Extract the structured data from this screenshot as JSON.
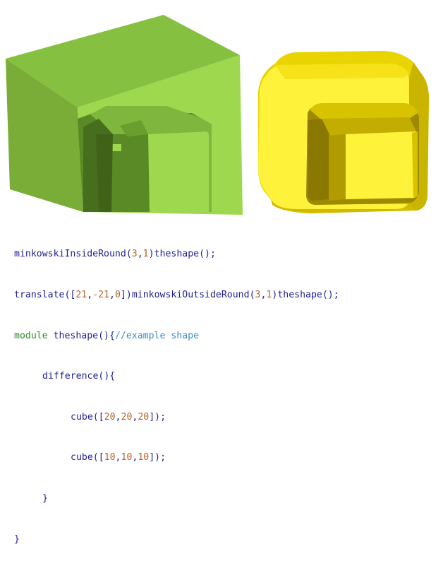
{
  "render": {
    "background": "#ffffff",
    "colors": {
      "green_light": "#9dd84f",
      "green_mid": "#7fb63d",
      "green_dark": "#5a8a26",
      "green_deep": "#476e1c",
      "yellow_light": "#fff23a",
      "yellow_mid": "#ead400",
      "yellow_dark": "#b7a100",
      "yellow_deep": "#8a7800"
    },
    "objects": [
      "minkowski-inside-round-shape",
      "minkowski-outside-round-shape"
    ]
  },
  "code": {
    "line1": {
      "fn": "minkowskiInsideRound",
      "args_open": "(",
      "a1": "3",
      "comma": ",",
      "a2": "1",
      "args_close": ")",
      "call": "theshape",
      "tail": "();"
    },
    "line2": {
      "fn": "translate",
      "open": "([",
      "x": "21",
      "c1": ",",
      "y": "-21",
      "c2": ",",
      "z": "0",
      "close": "])",
      "call1": "minkowskiOutsideRound",
      "p_open": "(",
      "a1": "3",
      "comma": ",",
      "a2": "1",
      "p_close": ")",
      "call2": "theshape",
      "tail": "();"
    },
    "line3": {
      "keyword": "module",
      "name": " theshape",
      "brace": "(){",
      "comment": "//example shape"
    },
    "line4": {
      "text": "difference(){"
    },
    "line5": {
      "fn": "cube",
      "open": "([",
      "v1": "20",
      "c1": ",",
      "v2": "20",
      "c2": ",",
      "v3": "20",
      "close": "]);"
    },
    "line6": {
      "fn": "cube",
      "open": "([",
      "v1": "10",
      "c1": ",",
      "v2": "10",
      "c2": ",",
      "v3": "10",
      "close": "]);"
    },
    "line7": {
      "text": "}"
    },
    "line8": {
      "text": "}"
    }
  }
}
